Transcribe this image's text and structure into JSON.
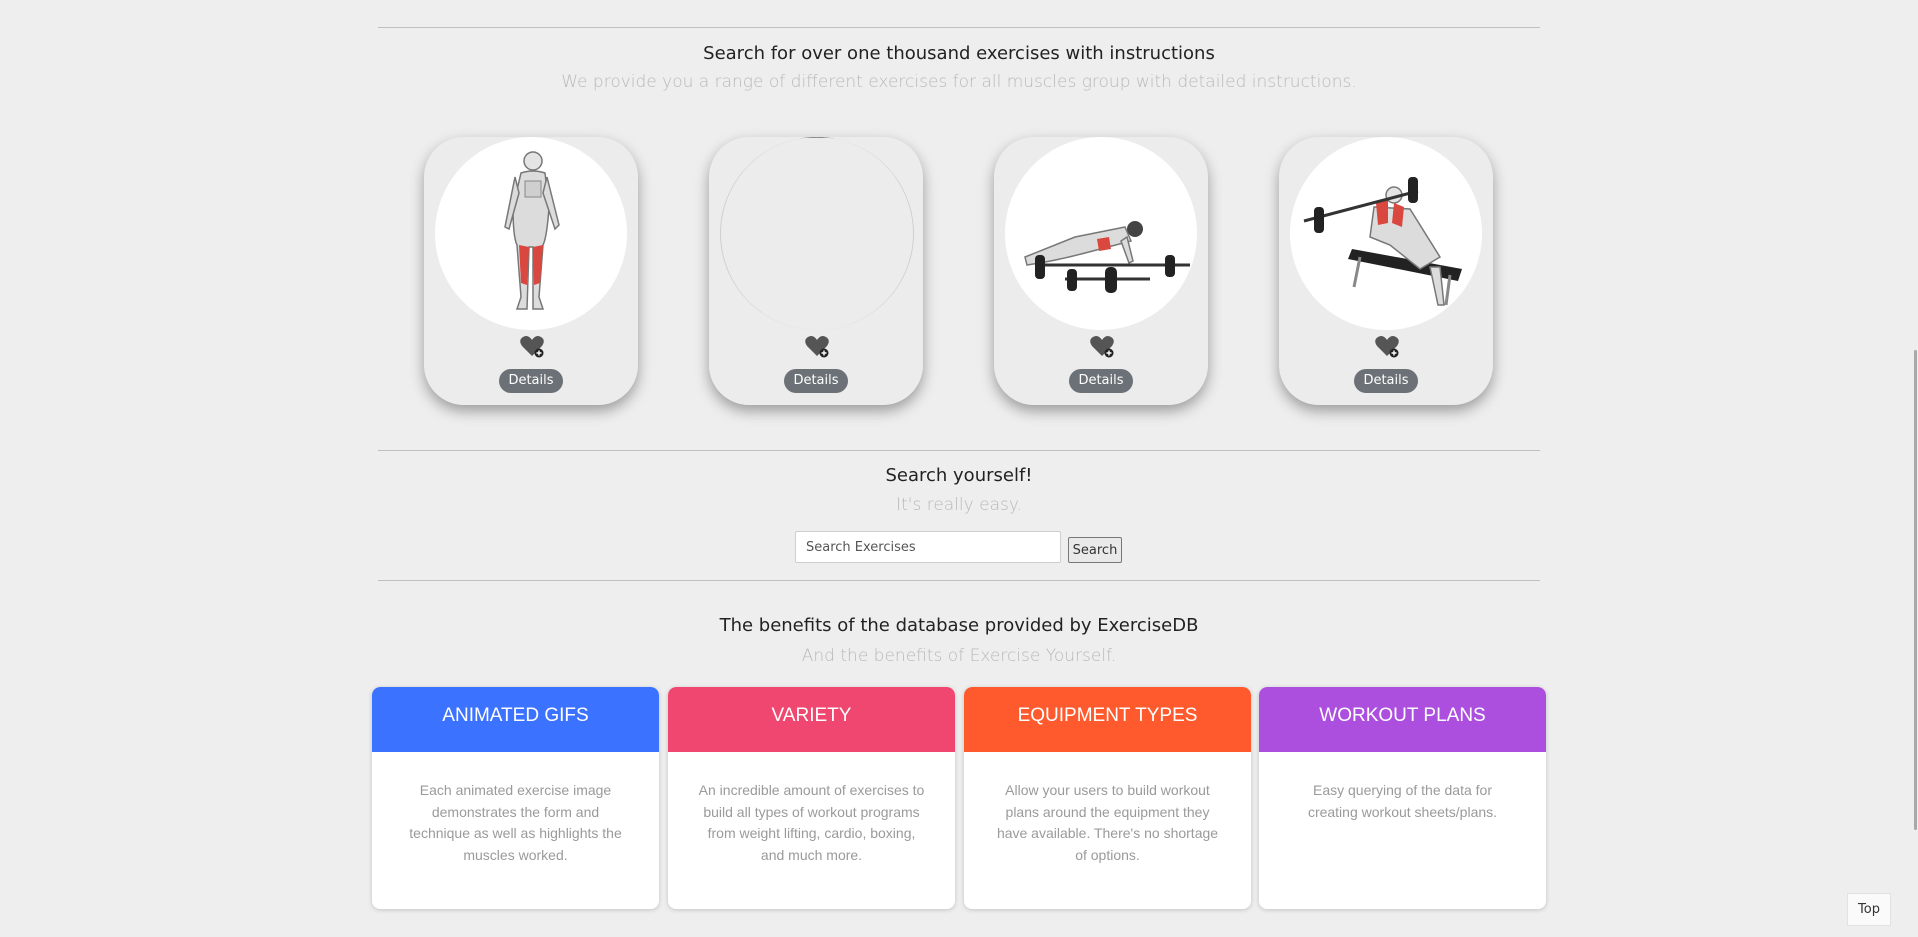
{
  "intro": {
    "title": "Search for over one thousand exercises with instructions",
    "subtitle": "We provide you a range of different exercises for all muscles group with detailed instructions."
  },
  "exercises": [
    {
      "image_icon": "standing-figure-quads-highlighted",
      "details_label": "Details"
    },
    {
      "image_icon": "image-loading-placeholder",
      "details_label": "Details"
    },
    {
      "image_icon": "barbell-push-up-figure",
      "details_label": "Details"
    },
    {
      "image_icon": "decline-bench-barbell-figure",
      "details_label": "Details"
    }
  ],
  "search": {
    "title": "Search yourself!",
    "subtitle": "It's really easy.",
    "placeholder": "Search Exercises",
    "button_label": "Search"
  },
  "benefits": {
    "title": "The benefits of the database provided by ExerciseDB",
    "subtitle": "And the benefits of Exercise Yourself.",
    "cards": [
      {
        "title": "ANIMATED GIFS",
        "color": "#3b72ff",
        "text": "Each animated exercise image demonstrates the form and technique as well as highlights the muscles worked."
      },
      {
        "title": "VARIETY",
        "color": "#ef476f",
        "text": "An incredible amount of exercises to build all types of workout programs from weight lifting, cardio, boxing, and much more."
      },
      {
        "title": "EQUIPMENT TYPES",
        "color": "#ff5a2e",
        "text": "Allow your users to build workout plans around the equipment they have available. There's no shortage of options."
      },
      {
        "title": "WORKOUT PLANS",
        "color": "#ac4fdf",
        "text": "Easy querying of the data for creating workout sheets/plans."
      }
    ]
  },
  "top_button_label": "Top"
}
